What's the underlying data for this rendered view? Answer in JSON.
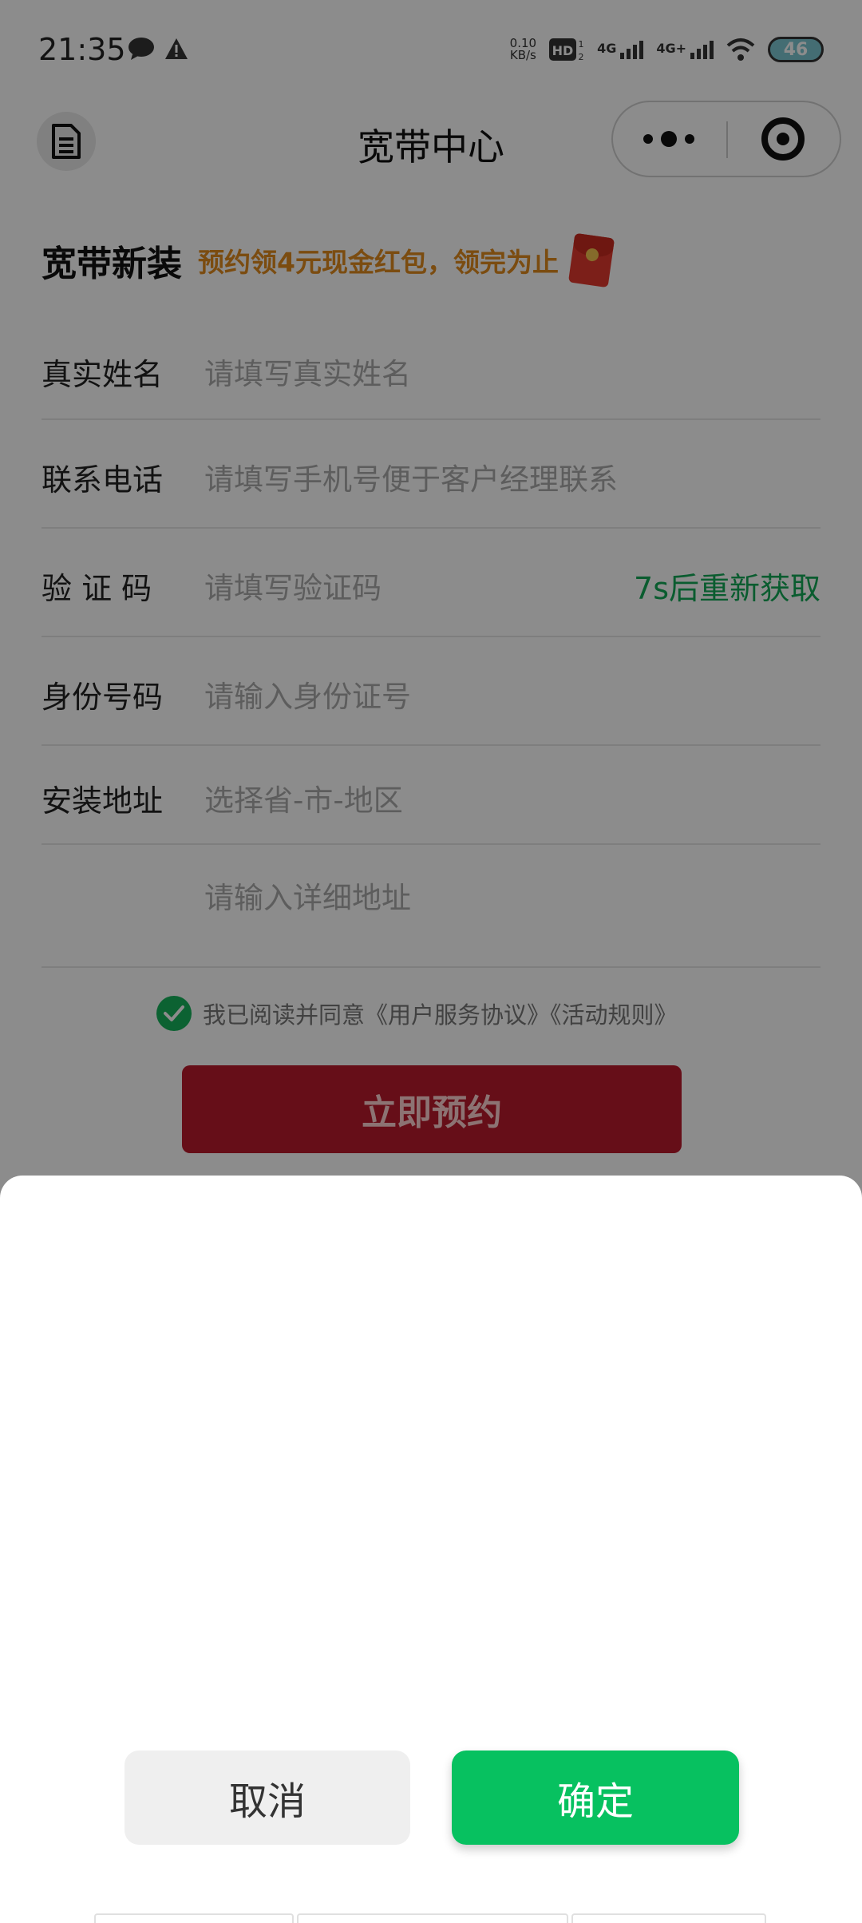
{
  "status_bar": {
    "time": "21:35",
    "net_speed_value": "0.10",
    "net_speed_unit": "KB/s",
    "hd_label": "HD",
    "signal_1_label": "4G",
    "signal_2_label": "4G+",
    "battery": "46"
  },
  "nav": {
    "title": "宽带中心"
  },
  "promo": {
    "title": "宽带新装",
    "subtitle": "预约领4元现金红包，领完为止"
  },
  "form": {
    "name": {
      "label": "真实姓名",
      "placeholder": "请填写真实姓名"
    },
    "phone": {
      "label": "联系电话",
      "placeholder": "请填写手机号便于客户经理联系"
    },
    "code": {
      "label": "验 证 码",
      "placeholder": "请填写验证码",
      "resend": "7s后重新获取"
    },
    "id_number": {
      "label": "身份号码",
      "placeholder": "请输入身份证号"
    },
    "address": {
      "label": "安装地址",
      "placeholder": "选择省-市-地区"
    },
    "address_detail": {
      "placeholder": "请输入详细地址"
    },
    "agreement": "我已阅读并同意《用户服务协议》《活动规则》",
    "submit": "立即预约"
  },
  "sheet": {
    "cancel": "取消",
    "confirm": "确定"
  },
  "colors": {
    "accent_green": "#07c160",
    "submit_red": "#bb1a2d",
    "promo_orange": "#e08a1e"
  }
}
